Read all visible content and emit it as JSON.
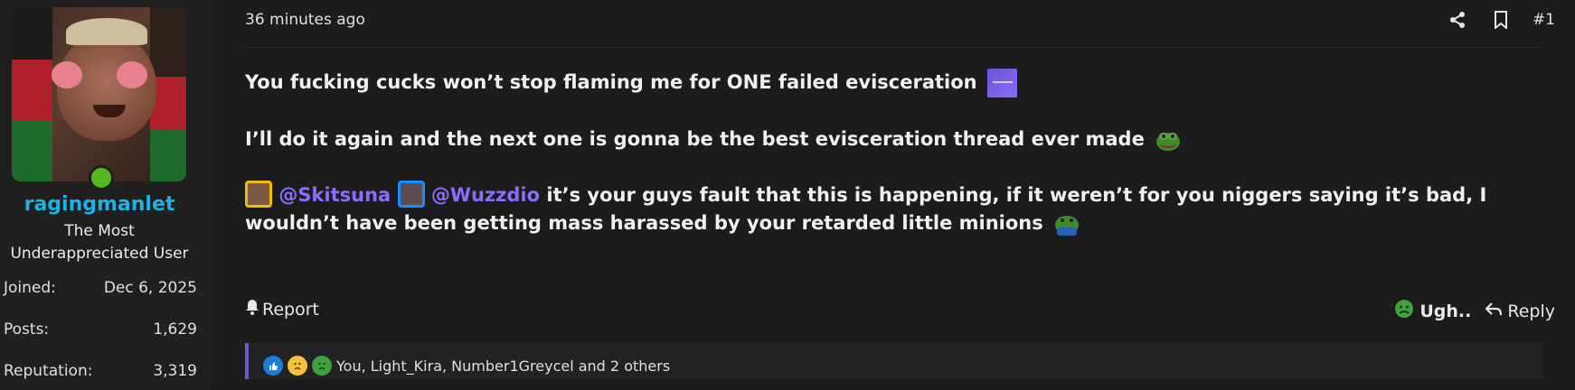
{
  "post": {
    "timestamp": "36 minutes ago",
    "post_number": "#1",
    "line1": "You fucking cucks won’t stop flaming me for ONE failed evisceration",
    "line2": "I’ll do it again and the next one is gonna be the best evisceration thread ever made",
    "mention1": "@Skitsuna",
    "mention2": "@Wuzzdio",
    "line3_rest": " it’s your guys fault that this is happening, if it weren’t for you niggers saying it’s bad, I wouldn’t have been getting mass harassed by your retarded little minions"
  },
  "user": {
    "name": "ragingmanlet",
    "title": "The Most Underappreciated User",
    "stats": [
      {
        "label": "Joined:",
        "value": "Dec 6, 2025"
      },
      {
        "label": "Posts:",
        "value": "1,629"
      },
      {
        "label": "Reputation:",
        "value": "3,319"
      }
    ]
  },
  "actions": {
    "report": "Report",
    "reaction": "Ugh..",
    "reply": "Reply"
  },
  "reactions": {
    "summary": "You, Light_Kira, Number1Greycel and 2 others"
  },
  "colors": {
    "username": "#1ab3e6",
    "mention": "#8a6cff",
    "online": "#56b61b"
  }
}
